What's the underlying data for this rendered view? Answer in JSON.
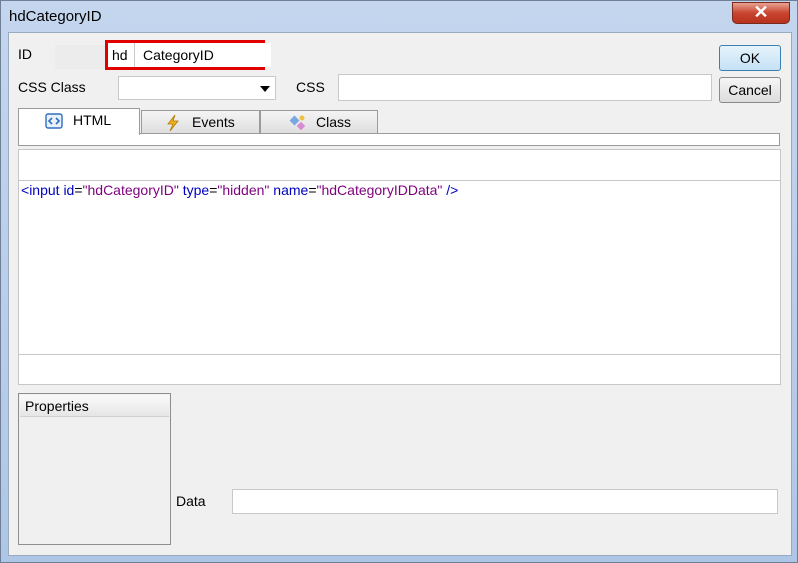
{
  "window": {
    "title": "hdCategoryID",
    "close_label": "✕"
  },
  "form": {
    "id_label": "ID",
    "id_prefix": "hd",
    "id_value": "CategoryID",
    "css_class_label": "CSS Class",
    "css_class_value": "",
    "css_label": "CSS",
    "css_value": "",
    "data_label": "Data",
    "data_value": ""
  },
  "buttons": {
    "ok": "OK",
    "cancel": "Cancel"
  },
  "tabs": [
    {
      "label": "HTML",
      "icon": "html-code-icon",
      "active": true
    },
    {
      "label": "Events",
      "icon": "lightning-icon",
      "active": false
    },
    {
      "label": "Class",
      "icon": "class-icon",
      "active": false
    }
  ],
  "code": {
    "open": "<",
    "tag": "input",
    "attr1": "id",
    "val1": "\"hdCategoryID\"",
    "attr2": "type",
    "val2": "\"hidden\"",
    "attr3": "name",
    "val3": "\"hdCategoryIDData\"",
    "close": "/>",
    "eq": "="
  },
  "properties": {
    "header": "Properties"
  }
}
